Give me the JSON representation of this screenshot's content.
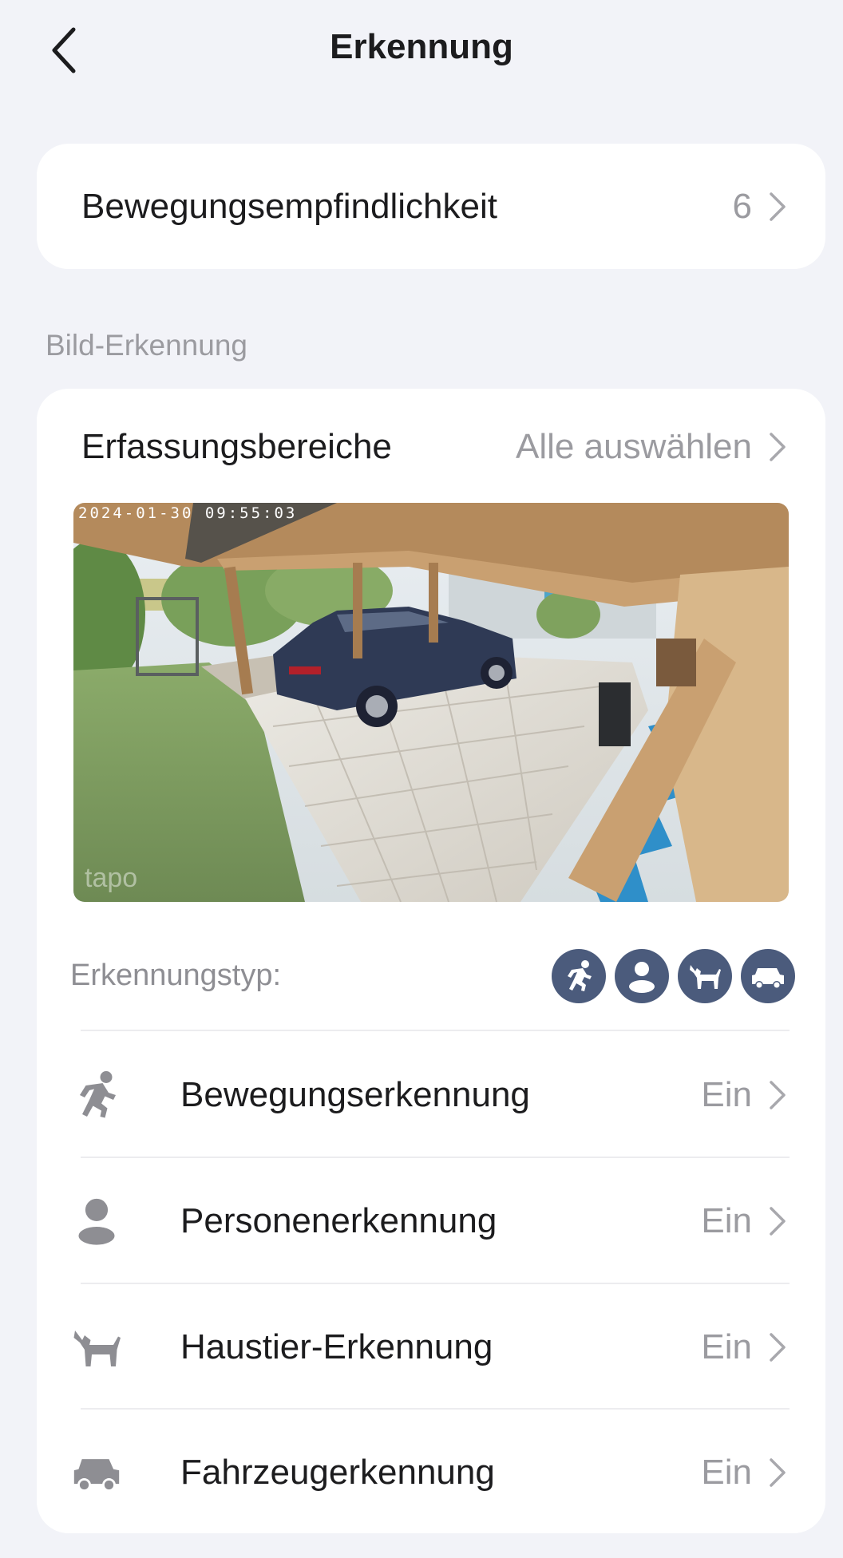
{
  "header": {
    "title": "Erkennung",
    "back_icon": "chevron-left-icon"
  },
  "sensitivity": {
    "label": "Bewegungsempfindlichkeit",
    "value": "6"
  },
  "section_label": "Bild-Erkennung",
  "detection_areas": {
    "label": "Erfassungsbereiche",
    "value": "Alle auswählen"
  },
  "preview": {
    "timestamp": "2024-01-30 09:55:03",
    "watermark": "tapo"
  },
  "detection_type": {
    "label": "Erkennungstyp:",
    "icons": [
      "motion-icon",
      "person-icon",
      "pet-icon",
      "vehicle-icon"
    ],
    "icon_bg": "#4b5b7c"
  },
  "items": [
    {
      "icon": "motion-icon",
      "label": "Bewegungserkennung",
      "value": "Ein"
    },
    {
      "icon": "person-icon",
      "label": "Personenerkennung",
      "value": "Ein"
    },
    {
      "icon": "pet-icon",
      "label": "Haustier-Erkennung",
      "value": "Ein"
    },
    {
      "icon": "vehicle-icon",
      "label": "Fahrzeugerkennung",
      "value": "Ein"
    }
  ],
  "colors": {
    "background": "#f2f3f8",
    "card": "#ffffff",
    "text": "#1c1c1e",
    "muted": "#9b9ba0",
    "icon_gray": "#8e8e93"
  }
}
